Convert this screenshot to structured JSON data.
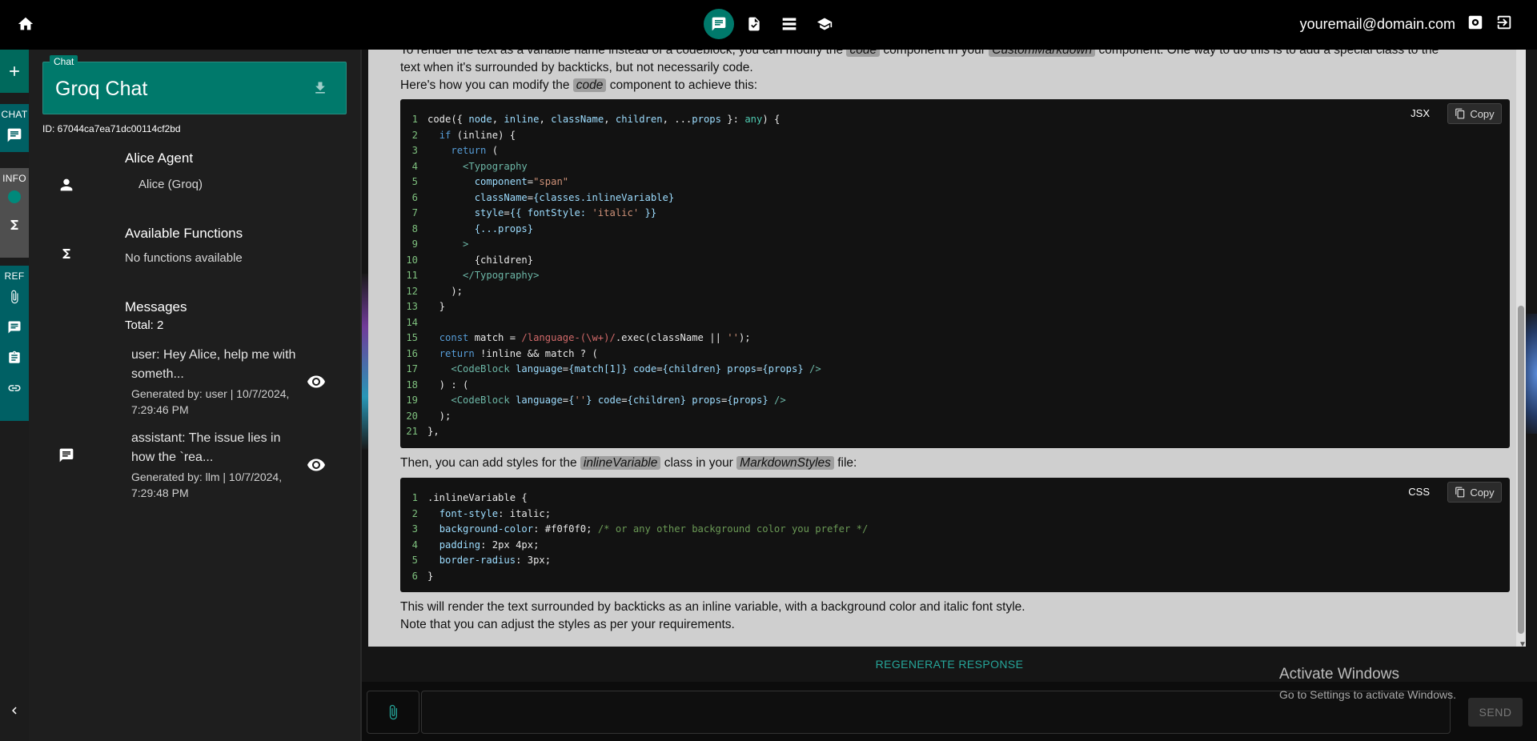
{
  "topbar": {
    "email": "youremail@domain.com",
    "icons": [
      "home-icon",
      "chat-icon",
      "document-check-icon",
      "list-icon",
      "school-icon",
      "settings-icon",
      "logout-icon"
    ]
  },
  "rail": {
    "chat_label": "CHAT",
    "info_label": "INFO",
    "ref_label": "REF"
  },
  "chat": {
    "tag": "Chat",
    "title": "Groq Chat",
    "id_text": "ID: 67044ca7ea71dc00114cf2bd"
  },
  "agent": {
    "title": "Alice Agent",
    "name": "Alice (Groq)"
  },
  "functions": {
    "title": "Available Functions",
    "subtitle": "No functions available"
  },
  "messages": {
    "title": "Messages",
    "total": "Total: 2",
    "items": [
      {
        "text": "user: Hey Alice, help me with someth...",
        "meta": "Generated by: user | 10/7/2024, 7:29:46 PM"
      },
      {
        "text": "assistant: The issue lies in how the `rea...",
        "meta": "Generated by: llm | 10/7/2024, 7:29:48 PM"
      }
    ]
  },
  "content": {
    "p1_a": "To render the text as a variable name instead of a codeblock, you can modify the",
    "p1_chip1": "code",
    "p1_b": "component in your",
    "p1_chip2": "CustomMarkdown",
    "p1_c": "component. One way to do this is to add a special class to the",
    "p2": "text when it's surrounded by backticks, but not necessarily code.",
    "p3_a": "Here's how you can modify the",
    "p3_chip": "code",
    "p3_b": "component to achieve this:",
    "code1_lang": "JSX",
    "code2_lang": "CSS",
    "copy_label": "Copy",
    "p4_a": "Then, you can add styles for the",
    "p4_chip1": "inlineVariable",
    "p4_b": "class in your",
    "p4_chip2": "MarkdownStyles",
    "p4_c": "file:",
    "p5": "This will render the text surrounded by backticks as an inline variable, with a background color and italic font style.",
    "p6": "Note that you can adjust the styles as per your requirements."
  },
  "actions": {
    "regenerate": "REGENERATE RESPONSE",
    "send": "SEND",
    "input_value": ""
  },
  "watermark": {
    "line1": "Activate Windows",
    "line2": "Go to Settings to activate Windows."
  }
}
